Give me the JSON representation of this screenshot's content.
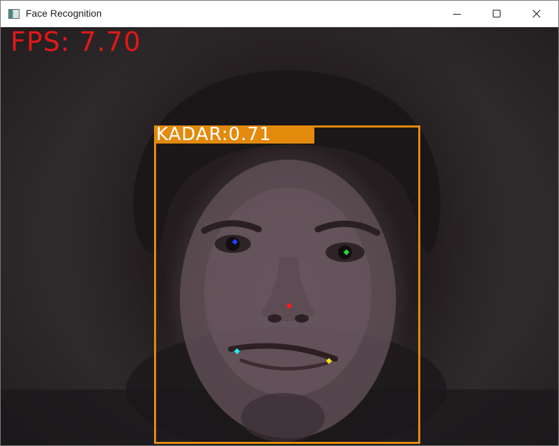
{
  "window": {
    "title": "Face Recognition",
    "icon": "opencv-window-icon"
  },
  "overlay": {
    "fps_text": "FPS: 7.70",
    "detections": [
      {
        "label_text": "KADAR:0.71",
        "name": "KADAR",
        "score": 0.71,
        "box_color": "#e38a0c"
      }
    ],
    "landmarks": [
      {
        "name": "left-eye",
        "color": "#2a3cff"
      },
      {
        "name": "right-eye",
        "color": "#22e03c"
      },
      {
        "name": "nose",
        "color": "#ff1a1a"
      },
      {
        "name": "mouth-left",
        "color": "#22e8e8"
      },
      {
        "name": "mouth-right",
        "color": "#ffe01a"
      }
    ]
  },
  "colors": {
    "fps": "#e21818",
    "box": "#e38a0c",
    "label_text": "#ffffff"
  }
}
